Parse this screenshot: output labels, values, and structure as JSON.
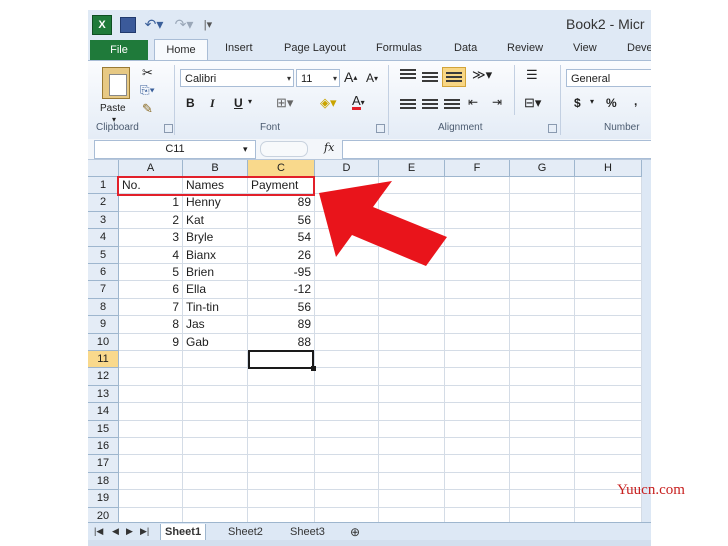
{
  "window": {
    "title": "Book2 - Micr",
    "quick_access": {
      "app_icon": "X"
    }
  },
  "tabs": [
    "File",
    "Home",
    "Insert",
    "Page Layout",
    "Formulas",
    "Data",
    "Review",
    "View",
    "Deve"
  ],
  "ribbon": {
    "clipboard": {
      "paste_label": "Paste",
      "group_label": "Clipboard"
    },
    "font": {
      "name": "Calibri",
      "size": "11",
      "bold": "B",
      "italic": "I",
      "underline": "U",
      "grow": "A",
      "shrink": "A",
      "font_color": "A",
      "group_label": "Font"
    },
    "alignment": {
      "group_label": "Alignment"
    },
    "number": {
      "format": "General",
      "currency": "$",
      "percent": "%",
      "comma": ",",
      "group_label": "Number"
    }
  },
  "formula_bar": {
    "name_box": "C11",
    "fx": "fx",
    "value": ""
  },
  "grid": {
    "columns": [
      "A",
      "B",
      "C",
      "D",
      "E",
      "F",
      "G",
      "H"
    ],
    "rows": [
      "1",
      "2",
      "3",
      "4",
      "5",
      "6",
      "7",
      "8",
      "9",
      "10",
      "11",
      "12",
      "13",
      "14",
      "15",
      "16",
      "17",
      "18",
      "19",
      "20"
    ],
    "header_row": [
      "No.",
      "Names",
      "Payment"
    ],
    "data": [
      [
        "1",
        "Henny",
        "89"
      ],
      [
        "2",
        "Kat",
        "56"
      ],
      [
        "3",
        "Bryle",
        "54"
      ],
      [
        "4",
        "Bianx",
        "26"
      ],
      [
        "5",
        "Brien",
        "-95"
      ],
      [
        "6",
        "Ella",
        "-12"
      ],
      [
        "7",
        "Tin-tin",
        "56"
      ],
      [
        "8",
        "Jas",
        "89"
      ],
      [
        "9",
        "Gab",
        "88"
      ]
    ],
    "active_cell": "C11"
  },
  "sheets": [
    "Sheet1",
    "Sheet2",
    "Sheet3"
  ],
  "watermark": "Yuucn.com",
  "colors": {
    "highlight": "#e2202a",
    "arrow": "#e9141b",
    "file_tab": "#1f7a3a",
    "selected_header": "#f9d98c"
  }
}
